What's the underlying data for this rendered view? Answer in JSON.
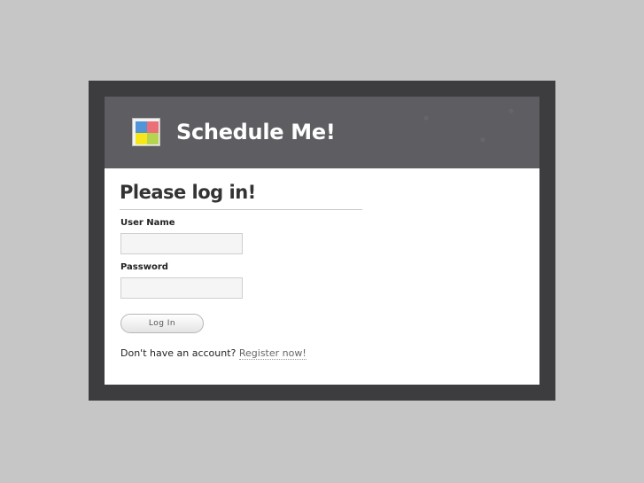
{
  "header": {
    "brand": "Schedule Me!"
  },
  "form": {
    "heading": "Please log in!",
    "username_label": "User Name",
    "username_value": "",
    "password_label": "Password",
    "password_value": "",
    "login_button": "Log In"
  },
  "footer": {
    "prompt": "Don't have an account?",
    "register_link": "Register now!"
  },
  "colors": {
    "page_bg": "#c6c6c6",
    "frame": "#3d3d40",
    "banner": "#5e5d61",
    "logo_blue": "#4f95d8",
    "logo_red": "#ea6f76",
    "logo_yellow": "#f7e61a",
    "logo_green": "#b5d44f"
  },
  "icons": {
    "logo": "schedule-logo-icon"
  }
}
